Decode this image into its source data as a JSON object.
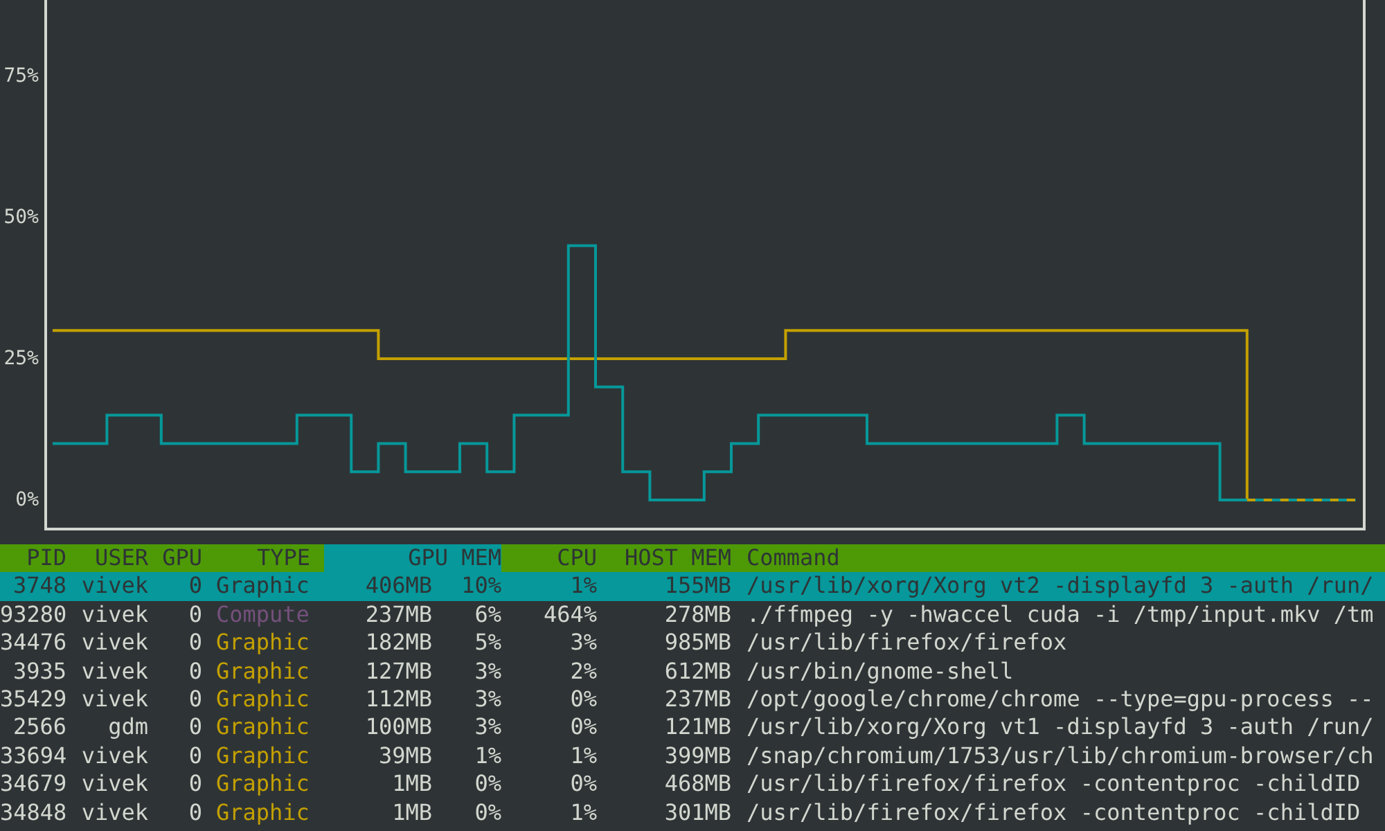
{
  "chart": {
    "y_axis_labels": [
      "75%",
      "50%",
      "25%",
      "0%"
    ]
  },
  "table": {
    "columns": [
      {
        "label": "PID",
        "selected": false
      },
      {
        "label": "USER",
        "selected": false
      },
      {
        "label": "GPU",
        "selected": false
      },
      {
        "label": "TYPE",
        "selected": false
      },
      {
        "label": "GPU MEM",
        "selected": true
      },
      {
        "label": "CPU",
        "selected": false
      },
      {
        "label": "HOST MEM",
        "selected": false
      },
      {
        "label": "Command",
        "selected": false
      }
    ],
    "rows": [
      {
        "selected": true,
        "pid": "3748",
        "user": "vivek",
        "gpu": "0",
        "type": "Graphic",
        "kind": "graphic",
        "gpu_mem": "406MB",
        "gpu_mem_pct": "10%",
        "cpu": "1%",
        "host_mem": "155MB",
        "command": "/usr/lib/xorg/Xorg vt2 -displayfd 3 -auth /run/"
      },
      {
        "selected": false,
        "pid": "93280",
        "user": "vivek",
        "gpu": "0",
        "type": "Compute",
        "kind": "compute",
        "gpu_mem": "237MB",
        "gpu_mem_pct": "6%",
        "cpu": "464%",
        "host_mem": "278MB",
        "command": "./ffmpeg -y -hwaccel cuda -i /tmp/input.mkv /tm"
      },
      {
        "selected": false,
        "pid": "34476",
        "user": "vivek",
        "gpu": "0",
        "type": "Graphic",
        "kind": "graphic",
        "gpu_mem": "182MB",
        "gpu_mem_pct": "5%",
        "cpu": "3%",
        "host_mem": "985MB",
        "command": "/usr/lib/firefox/firefox"
      },
      {
        "selected": false,
        "pid": "3935",
        "user": "vivek",
        "gpu": "0",
        "type": "Graphic",
        "kind": "graphic",
        "gpu_mem": "127MB",
        "gpu_mem_pct": "3%",
        "cpu": "2%",
        "host_mem": "612MB",
        "command": "/usr/bin/gnome-shell"
      },
      {
        "selected": false,
        "pid": "35429",
        "user": "vivek",
        "gpu": "0",
        "type": "Graphic",
        "kind": "graphic",
        "gpu_mem": "112MB",
        "gpu_mem_pct": "3%",
        "cpu": "0%",
        "host_mem": "237MB",
        "command": "/opt/google/chrome/chrome --type=gpu-process --"
      },
      {
        "selected": false,
        "pid": "2566",
        "user": "gdm",
        "gpu": "0",
        "type": "Graphic",
        "kind": "graphic",
        "gpu_mem": "100MB",
        "gpu_mem_pct": "3%",
        "cpu": "0%",
        "host_mem": "121MB",
        "command": "/usr/lib/xorg/Xorg vt1 -displayfd 3 -auth /run/"
      },
      {
        "selected": false,
        "pid": "33694",
        "user": "vivek",
        "gpu": "0",
        "type": "Graphic",
        "kind": "graphic",
        "gpu_mem": "39MB",
        "gpu_mem_pct": "1%",
        "cpu": "1%",
        "host_mem": "399MB",
        "command": "/snap/chromium/1753/usr/lib/chromium-browser/ch"
      },
      {
        "selected": false,
        "pid": "34679",
        "user": "vivek",
        "gpu": "0",
        "type": "Graphic",
        "kind": "graphic",
        "gpu_mem": "1MB",
        "gpu_mem_pct": "0%",
        "cpu": "0%",
        "host_mem": "468MB",
        "command": "/usr/lib/firefox/firefox -contentproc -childID"
      },
      {
        "selected": false,
        "pid": "34848",
        "user": "vivek",
        "gpu": "0",
        "type": "Graphic",
        "kind": "graphic",
        "gpu_mem": "1MB",
        "gpu_mem_pct": "0%",
        "cpu": "1%",
        "host_mem": "301MB",
        "command": "/usr/lib/firefox/firefox -contentproc -childID"
      }
    ]
  }
}
